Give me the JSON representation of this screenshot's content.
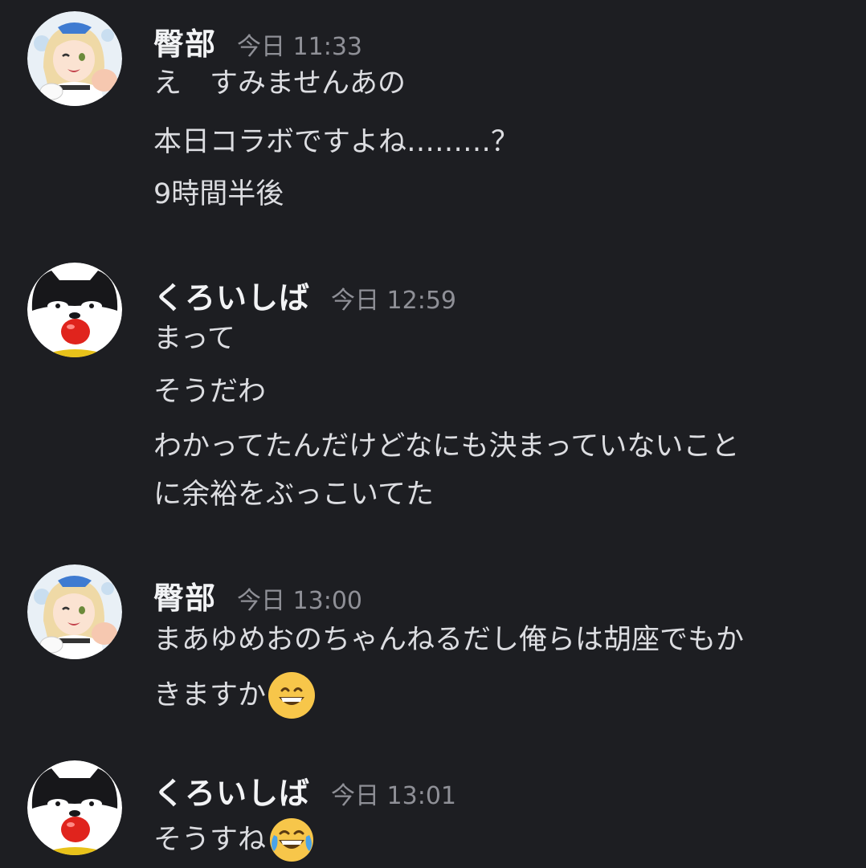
{
  "messages": [
    {
      "author": "臀部",
      "timestamp": "今日 11:33",
      "avatar": "anime-girl-avatar",
      "lines": [
        "え　すみませんあの",
        "本日コラボですよね………？",
        "9時間半後"
      ]
    },
    {
      "author": "くろいしば",
      "timestamp": "今日 12:59",
      "avatar": "black-shiba-avatar",
      "lines": [
        "まって",
        "そうだわ",
        "わかってたんだけどなにも決まっていないこと",
        "に余裕をぶっこいてた"
      ]
    },
    {
      "author": "臀部",
      "timestamp": "今日 13:00",
      "avatar": "anime-girl-avatar",
      "lines": [
        "まあゆめおのちゃんねるだし俺らは胡座でもか",
        "きますか"
      ],
      "emoji": "grinning-face-emoji"
    },
    {
      "author": "くろいしば",
      "timestamp": "今日 13:01",
      "avatar": "black-shiba-avatar",
      "lines": [
        "そうすね"
      ],
      "emoji": "tears-of-joy-emoji"
    }
  ],
  "colors": {
    "background": "#1d1e22",
    "username": "#f2f3f5",
    "timestamp": "#8f9097",
    "text": "#dcdde1"
  }
}
